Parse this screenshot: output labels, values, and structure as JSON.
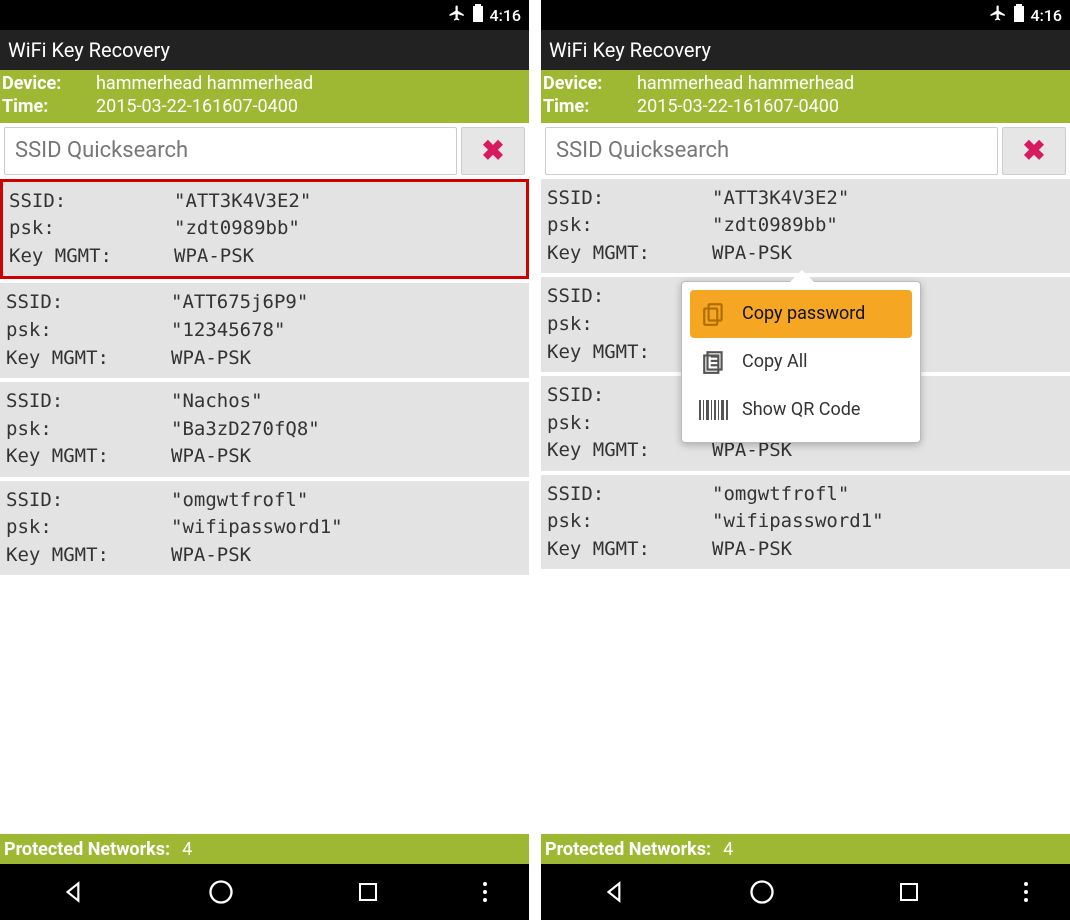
{
  "status": {
    "clock": "4:16"
  },
  "app": {
    "title": "WiFi Key Recovery"
  },
  "info": {
    "device_label": "Device:",
    "device_value": "hammerhead hammerhead",
    "time_label": "Time:",
    "time_value": "2015-03-22-161607-0400"
  },
  "search": {
    "placeholder": "SSID Quicksearch"
  },
  "labels": {
    "ssid": "SSID:",
    "psk": "psk:",
    "keymgmt": "Key MGMT:"
  },
  "networks": [
    {
      "ssid": "\"ATT3K4V3E2\"",
      "psk": "\"zdt0989bb\"",
      "keymgmt": "WPA-PSK"
    },
    {
      "ssid": "\"ATT675j6P9\"",
      "psk": "\"12345678\"",
      "keymgmt": "WPA-PSK"
    },
    {
      "ssid": "\"Nachos\"",
      "psk": "\"Ba3zD270fQ8\"",
      "keymgmt": "WPA-PSK"
    },
    {
      "ssid": "\"omgwtfrofl\"",
      "psk": "\"wifipassword1\"",
      "keymgmt": "WPA-PSK"
    }
  ],
  "footer": {
    "label": "Protected Networks:",
    "count": "4"
  },
  "popup": {
    "copy_password": "Copy password",
    "copy_all": "Copy All",
    "show_qr": "Show QR Code"
  }
}
